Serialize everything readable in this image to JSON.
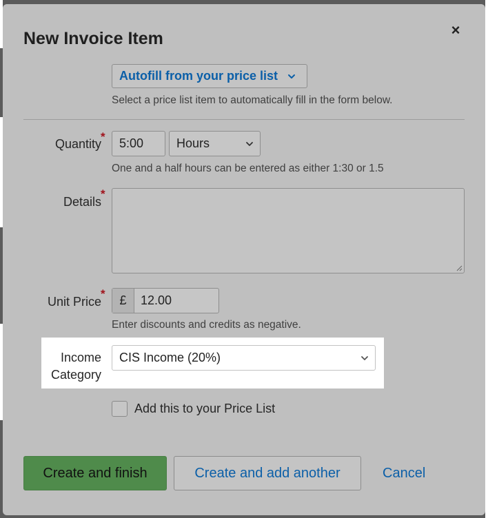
{
  "dialog": {
    "title": "New Invoice Item",
    "close_glyph": "×"
  },
  "autofill": {
    "label": "Autofill from your price list",
    "hint": "Select a price list item to automatically fill in the form below."
  },
  "quantity": {
    "label": "Quantity",
    "value": "5:00",
    "unit": "Hours",
    "hint": "One and a half hours can be entered as either 1:30 or 1.5"
  },
  "details": {
    "label": "Details",
    "value": ""
  },
  "unit_price": {
    "label": "Unit Price",
    "currency": "£",
    "value": "12.00",
    "hint": "Enter discounts and credits as negative."
  },
  "income_category": {
    "label_line1": "Income",
    "label_line2": "Category",
    "value": "CIS Income (20%)"
  },
  "price_list_checkbox": {
    "label": "Add this to your Price List",
    "checked": false
  },
  "actions": {
    "primary": "Create and finish",
    "secondary": "Create and add another",
    "cancel": "Cancel"
  },
  "required_marker": "*",
  "colors": {
    "accent_link": "#0b5fa8",
    "primary_button": "#4f8b4b",
    "required": "#a0121b"
  }
}
